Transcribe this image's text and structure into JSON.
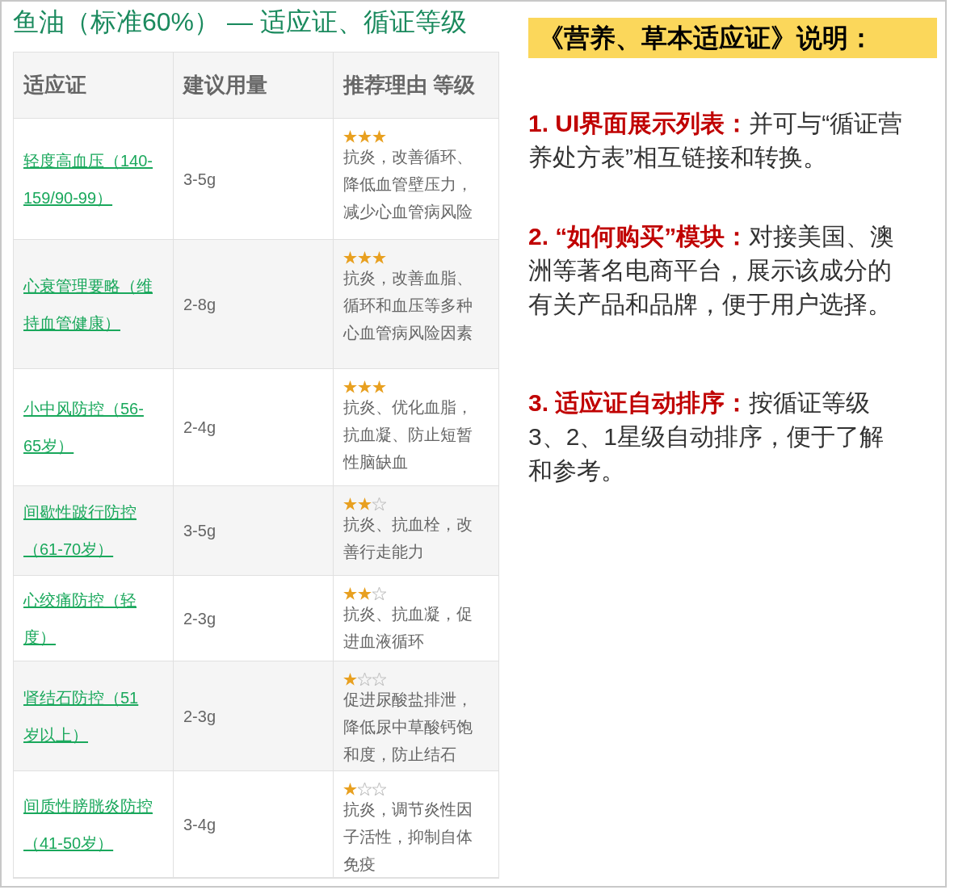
{
  "title": "鱼油（标准60%） — 适应证、循证等级",
  "table": {
    "columns": [
      "适应证",
      "建议用量",
      "推荐理由 等级"
    ],
    "rows": [
      {
        "indication": "轻度高血压（140-159/90-99）",
        "dose": "3-5g",
        "stars": 3,
        "reason": "抗炎，改善循环、降低血管壁压力，减少心血管病风险"
      },
      {
        "indication": "心衰管理要略（维持血管健康）",
        "dose": "2-8g",
        "stars": 3,
        "reason": "抗炎，改善血脂、循环和血压等多种心血管病风险因素"
      },
      {
        "indication": "小中风防控（56-65岁）",
        "dose": "2-4g",
        "stars": 3,
        "reason": "抗炎、优化血脂，抗血凝、防止短暂性脑缺血"
      },
      {
        "indication": "间歇性跛行防控（61-70岁）",
        "dose": "3-5g",
        "stars": 2,
        "reason": "抗炎、抗血栓，改善行走能力"
      },
      {
        "indication": "心绞痛防控（轻度）",
        "dose": "2-3g",
        "stars": 2,
        "reason": "抗炎、抗血凝，促进血液循环"
      },
      {
        "indication": "肾结石防控（51岁以上）",
        "dose": "2-3g",
        "stars": 1,
        "reason": "促进尿酸盐排泄，降低尿中草酸钙饱和度，防止结石"
      },
      {
        "indication": "间质性膀胱炎防控（41-50岁）",
        "dose": "3-4g",
        "stars": 1,
        "reason": "抗炎，调节炎性因子活性，抑制自体免疫"
      }
    ]
  },
  "notes_heading": "《营养、草本适应证》说明：",
  "notes": [
    {
      "label": "1. UI界面展示列表：",
      "text": "并可与“循证营养处方表”相互链接和转换。"
    },
    {
      "label": "2. “如何购买”模块：",
      "text": "对接美国、澳洲等著名电商平台，展示该成分的有关产品和品牌，便于用户选择。"
    },
    {
      "label": "3. 适应证自动排序：",
      "text": "按循证等级3、2、1星级自动排序，便于了解和参考。"
    }
  ]
}
